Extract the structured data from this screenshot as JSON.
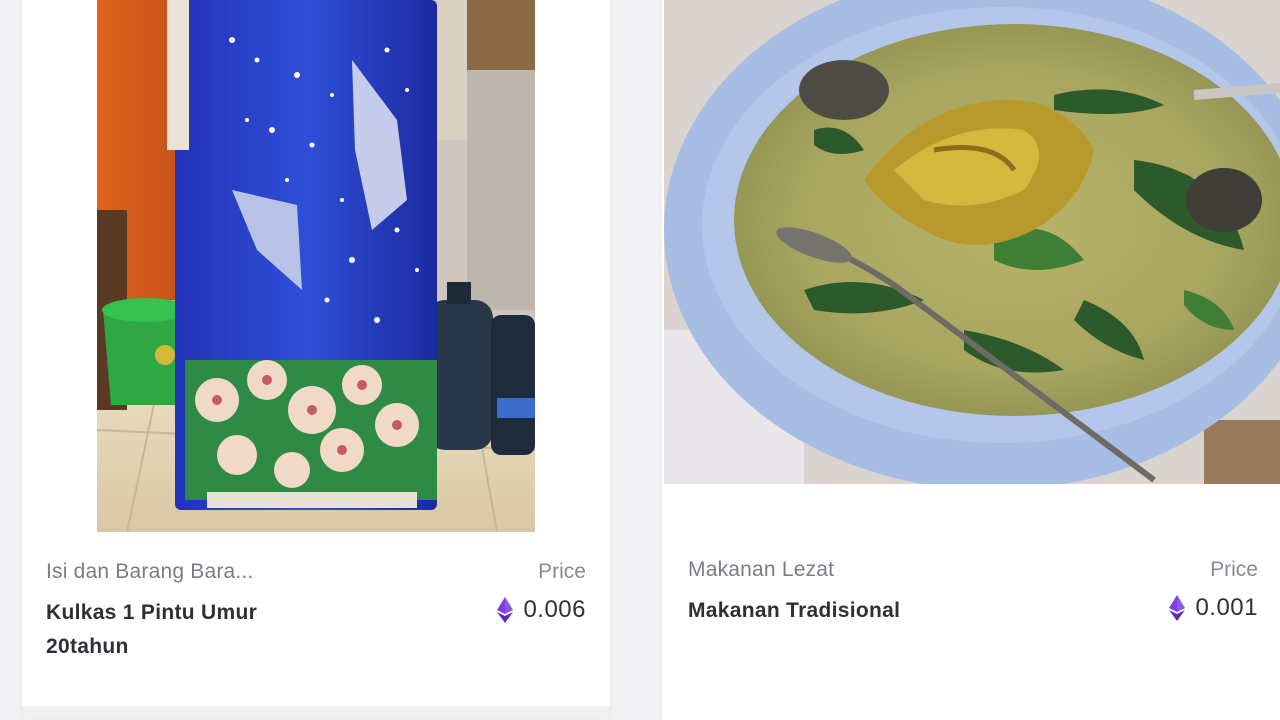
{
  "listings": [
    {
      "category": "Isi dan Barang Bara...",
      "title": "Kulkas 1 Pintu Umur 20tahun",
      "price_label": "Price",
      "price": "0.006",
      "currency_icon": "ethereum-icon",
      "image": "refrigerator-with-blue-butterfly-cover-photo"
    },
    {
      "category": "Makanan Lezat",
      "title": "Makanan Tradisional",
      "price_label": "Price",
      "price": "0.001",
      "currency_icon": "ethereum-icon",
      "image": "bowl-of-vegetable-fish-soup-photo"
    }
  ],
  "colors": {
    "eth_purple": "#7b3fe4",
    "title_text": "#2f2f36",
    "muted_text": "#7b7b86"
  }
}
